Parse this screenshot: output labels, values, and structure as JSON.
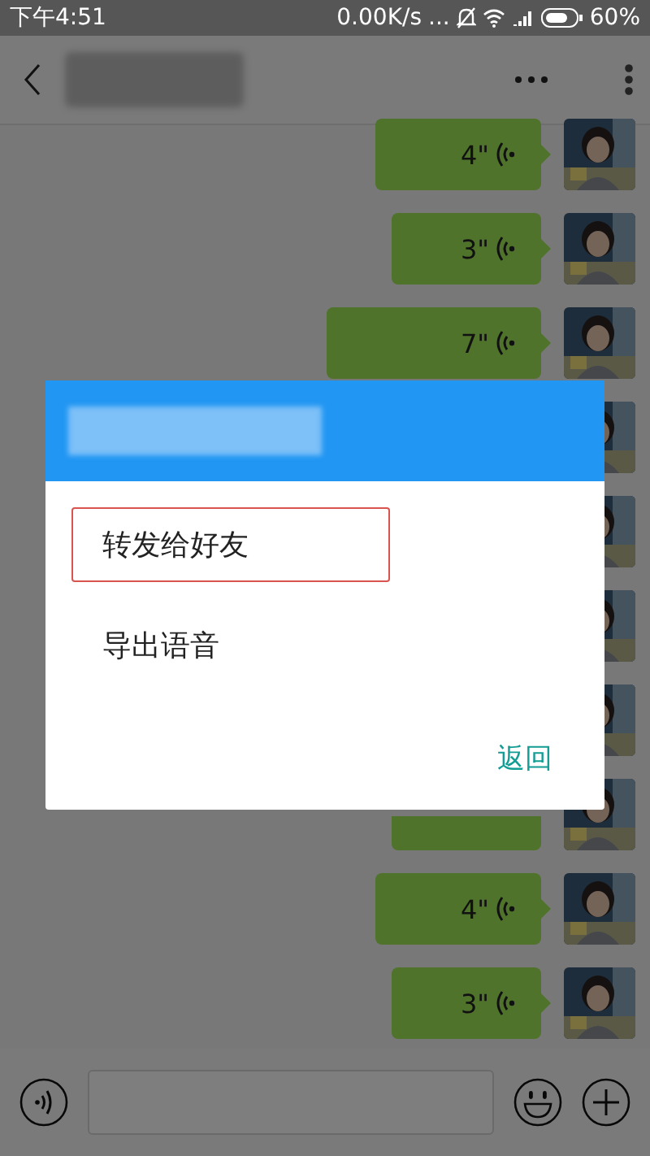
{
  "status_bar": {
    "time": "下午4:51",
    "speed": "0.00K/s",
    "more": "...",
    "battery": "60%"
  },
  "messages": [
    {
      "kind": "voice",
      "duration": "4\""
    },
    {
      "kind": "voice",
      "duration": "3\""
    },
    {
      "kind": "voice",
      "duration": "7\""
    },
    {
      "kind": "covered"
    },
    {
      "kind": "covered"
    },
    {
      "kind": "covered"
    },
    {
      "kind": "covered"
    },
    {
      "kind": "partial"
    },
    {
      "kind": "voice",
      "duration": "4\""
    },
    {
      "kind": "voice",
      "duration": "3\""
    }
  ],
  "dialog": {
    "items": [
      {
        "label": "转发给好友",
        "highlighted": true
      },
      {
        "label": "导出语音",
        "highlighted": false
      }
    ],
    "cancel": "返回"
  }
}
